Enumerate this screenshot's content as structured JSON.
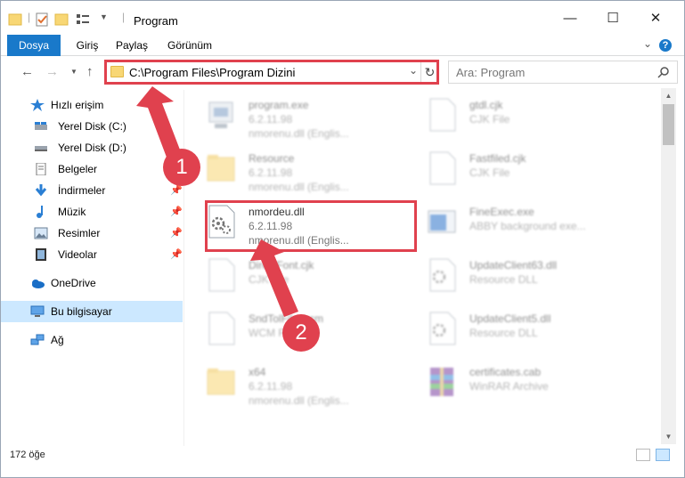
{
  "window": {
    "title": "Program",
    "minimize": "—",
    "maximize": "☐",
    "close": "✕"
  },
  "ribbon": {
    "tabs": [
      "Dosya",
      "Giriş",
      "Paylaş",
      "Görünüm"
    ],
    "help": "?"
  },
  "nav": {
    "address": "C:\\Program Files\\Program Dizini",
    "search_placeholder": "Ara: Program"
  },
  "sidebar": {
    "items": [
      {
        "label": "Hızlı erişim",
        "icon": "star-icon"
      },
      {
        "label": "Yerel Disk (C:)",
        "icon": "drive-icon"
      },
      {
        "label": "Yerel Disk (D:)",
        "icon": "drive-icon"
      },
      {
        "label": "Belgeler",
        "icon": "documents-icon"
      },
      {
        "label": "İndirmeler",
        "icon": "download-icon"
      },
      {
        "label": "Müzik",
        "icon": "music-icon"
      },
      {
        "label": "Resimler",
        "icon": "pictures-icon"
      },
      {
        "label": "Videolar",
        "icon": "video-icon"
      },
      {
        "label": "OneDrive",
        "icon": "cloud-icon"
      },
      {
        "label": "Bu bilgisayar",
        "icon": "computer-icon"
      },
      {
        "label": "Ağ",
        "icon": "network-icon"
      }
    ]
  },
  "files": [
    {
      "name": "program.exe",
      "version": "6.2.11.98",
      "desc": "nmorenu.dll (Englis...",
      "icon": "exe-icon"
    },
    {
      "name": "Resource",
      "version": "6.2.11.98",
      "desc": "nmorenu.dll (Englis...",
      "icon": "folder-icon"
    },
    {
      "name": "nmordeu.dll",
      "version": "6.2.11.98",
      "desc": "nmorenu.dll (Englis...",
      "icon": "dll-icon"
    },
    {
      "name": "DirectFont.cjk",
      "version": "CJK File",
      "desc": "",
      "icon": "file-icon"
    },
    {
      "name": "SndTolFile.wcm",
      "version": "WCM File",
      "desc": "",
      "icon": "file-icon"
    },
    {
      "name": "x64",
      "version": "6.2.11.98",
      "desc": "nmorenu.dll (Englis...",
      "icon": "folder-icon"
    },
    {
      "name": "gtdl.cjk",
      "version": "CJK File",
      "desc": "",
      "icon": "file-icon"
    },
    {
      "name": "Fastfiled.cjk",
      "version": "CJK File",
      "desc": "",
      "icon": "file-icon"
    },
    {
      "name": "FineExec.exe",
      "version": "ABBY background exe...",
      "desc": "",
      "icon": "app-icon"
    },
    {
      "name": "UpdateClient63.dll",
      "version": "Resource DLL",
      "desc": "",
      "icon": "dll-icon"
    },
    {
      "name": "UpdateClient5.dll",
      "version": "Resource DLL",
      "desc": "",
      "icon": "dll-icon"
    },
    {
      "name": "certificates.cab",
      "version": "WinRAR Archive",
      "desc": "",
      "icon": "archive-icon"
    }
  ],
  "status": {
    "count": "172 öğe"
  },
  "callouts": [
    "1",
    "2"
  ],
  "colors": {
    "accent": "#1979ca",
    "highlight": "#e0414e",
    "selection": "#cce8ff"
  }
}
